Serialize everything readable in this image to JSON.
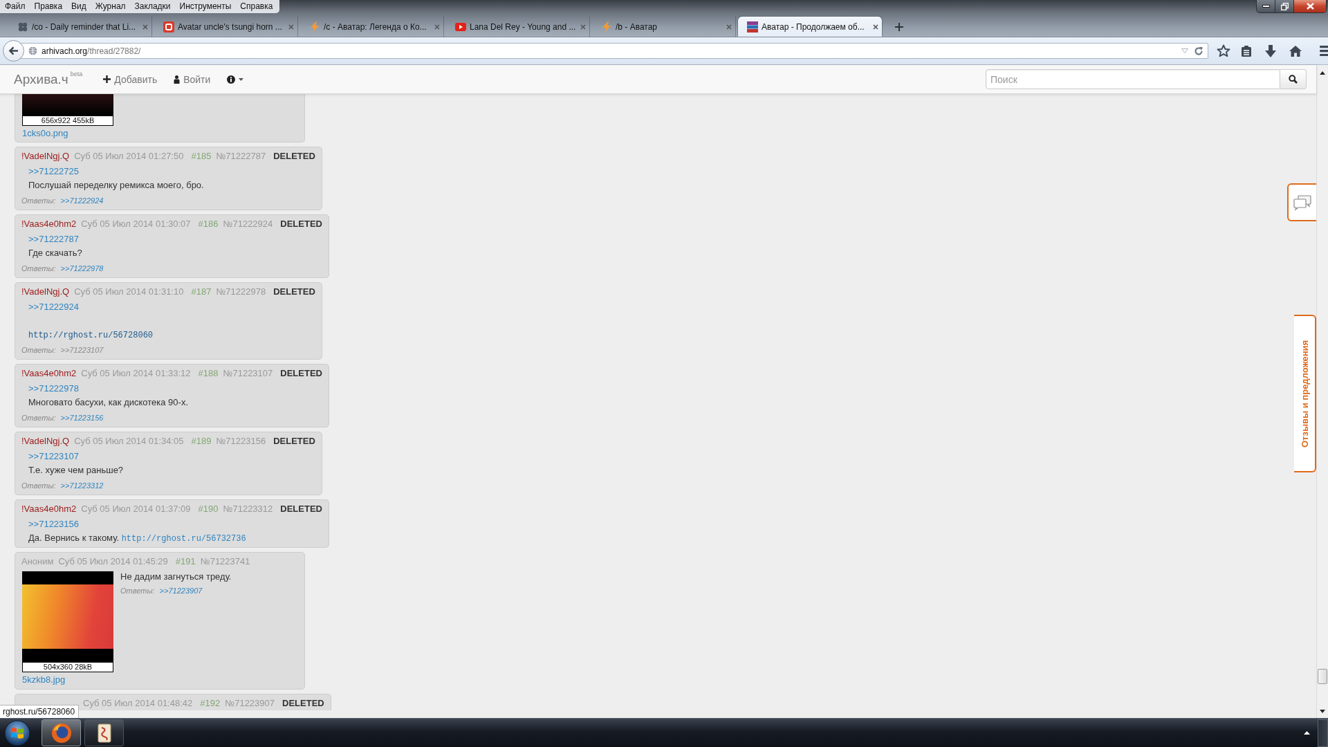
{
  "menu": [
    "Файл",
    "Правка",
    "Вид",
    "Журнал",
    "Закладки",
    "Инструменты",
    "Справка"
  ],
  "tabs": [
    {
      "title": "/co - Daily reminder that Li...",
      "kind": "clover",
      "selected": false
    },
    {
      "title": "Avatar uncle's tsungi horn ...",
      "kind": "app",
      "selected": false
    },
    {
      "title": "/c - Аватар: Легенда о Ко...",
      "kind": "bolt",
      "selected": false
    },
    {
      "title": "Lana Del Rey - Young and ...",
      "kind": "video",
      "selected": false
    },
    {
      "title": "/b - Аватар",
      "kind": "bolt",
      "selected": false
    },
    {
      "title": "Аватар - Продолжаем об...",
      "kind": "books",
      "selected": true
    }
  ],
  "address": {
    "host": "arhivach.org",
    "path": "/thread/27882/"
  },
  "site_nav": {
    "brand": "Архива.ч",
    "badge": "beta",
    "items": [
      {
        "kind": "plus",
        "label": "Добавить"
      },
      {
        "kind": "person",
        "label": "Войти"
      },
      {
        "kind": "info"
      }
    ]
  },
  "search": {
    "placeholder": "Поиск"
  },
  "posts": [
    {
      "cut": true,
      "image": {
        "caption": "656x922 455kB",
        "file": "1cks0o.png"
      }
    },
    {
      "cut": false,
      "author": {
        "name": "!VadelNgj.Q",
        "anonymous": false
      },
      "date": "Суб 05 Июл 2014 01:27:50",
      "num": "#185",
      "id": "№71222787",
      "status": "DELETED",
      "body": [
        {
          "kind": "quote",
          "text": ">>71222725"
        },
        {
          "kind": "text",
          "text": "Послушай переделку ремикса моего, бро."
        }
      ],
      "replies": {
        "label": "Ответы:",
        "links": [
          {
            "text": ">>71222924",
            "visited": false
          }
        ]
      }
    },
    {
      "cut": false,
      "author": {
        "name": "!Vaas4e0hm2",
        "anonymous": false
      },
      "date": "Суб 05 Июл 2014 01:30:07",
      "num": "#186",
      "id": "№71222924",
      "status": "DELETED",
      "body": [
        {
          "kind": "quote",
          "text": ">>71222787"
        },
        {
          "kind": "text",
          "text": "Где скачать?"
        }
      ],
      "replies": {
        "label": "Ответы:",
        "links": [
          {
            "text": ">>71222978",
            "visited": false
          }
        ]
      }
    },
    {
      "cut": false,
      "author": {
        "name": "!VadelNgj.Q",
        "anonymous": false
      },
      "date": "Суб 05 Июл 2014 01:31:10",
      "num": "#187",
      "id": "№71222978",
      "status": "DELETED",
      "body": [
        {
          "kind": "quote",
          "text": ">>71222924"
        },
        {
          "kind": "blank"
        },
        {
          "kind": "link",
          "text": "http://rghost.ru/56728060",
          "hovered": true
        }
      ],
      "replies": {
        "label": "Ответы:",
        "links": [
          {
            "text": ">>71223107",
            "visited": true
          }
        ]
      }
    },
    {
      "cut": false,
      "author": {
        "name": "!Vaas4e0hm2",
        "anonymous": false
      },
      "date": "Суб 05 Июл 2014 01:33:12",
      "num": "#188",
      "id": "№71223107",
      "status": "DELETED",
      "body": [
        {
          "kind": "quote",
          "text": ">>71222978"
        },
        {
          "kind": "text",
          "text": "Многовато басухи, как дискотека 90-х."
        }
      ],
      "replies": {
        "label": "Ответы:",
        "links": [
          {
            "text": ">>71223156",
            "visited": false
          }
        ]
      }
    },
    {
      "cut": false,
      "author": {
        "name": "!VadelNgj.Q",
        "anonymous": false
      },
      "date": "Суб 05 Июл 2014 01:34:05",
      "num": "#189",
      "id": "№71223156",
      "status": "DELETED",
      "body": [
        {
          "kind": "quote",
          "text": ">>71223107"
        },
        {
          "kind": "text",
          "text": "Т.е. хуже чем раньше?"
        }
      ],
      "replies": {
        "label": "Ответы:",
        "links": [
          {
            "text": ">>71223312",
            "visited": false
          }
        ]
      }
    },
    {
      "cut": false,
      "author": {
        "name": "!Vaas4e0hm2",
        "anonymous": false
      },
      "date": "Суб 05 Июл 2014 01:37:09",
      "num": "#190",
      "id": "№71223312",
      "status": "DELETED",
      "body": [
        {
          "kind": "quote",
          "text": ">>71223156"
        },
        {
          "kind": "text",
          "text": "Да. Вернись к такому.",
          "link": {
            "text": "http://rghost.ru/56732736",
            "hovered": false
          }
        }
      ]
    },
    {
      "cut": false,
      "author": {
        "name": "Аноним",
        "anonymous": true
      },
      "date": "Суб 05 Июл 2014 01:45:29",
      "num": "#191",
      "id": "№71223741",
      "image": {
        "caption": "504x360 28kB",
        "file": "5kzkb8.jpg"
      },
      "body": [
        {
          "kind": "text",
          "text": "Не дадим загнуться треду."
        }
      ],
      "replies": {
        "label": "Ответы:",
        "links": [
          {
            "text": ">>71223907",
            "visited": false
          }
        ]
      }
    },
    {
      "cut": false,
      "date": "Суб 05 Июл 2014 01:48:42",
      "num": "#192",
      "id": "№71223907",
      "status": "DELETED"
    }
  ],
  "feedback_tab": "Отзывы и предложения",
  "status_link": "rghost.ru/56728060"
}
